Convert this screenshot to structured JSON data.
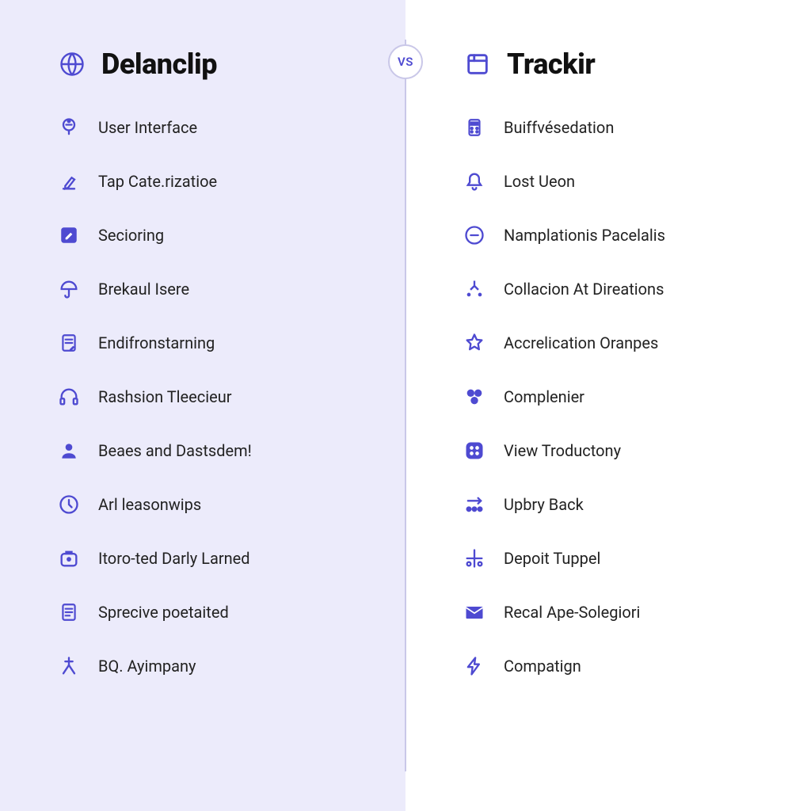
{
  "vs_label": "VS",
  "left": {
    "title": "Delanclip",
    "features": [
      "User Interface",
      "Tap Cate.rizatioe",
      "Secioring",
      "Brekaul Isere",
      "Endifronstarning",
      "Rashsion Tleecieur",
      "Beaes and Dastsdem!",
      "Arl leasonwips",
      "Itoro-ted Darly Larned",
      "Sprecive poetaited",
      "BQ. Ayimpany"
    ]
  },
  "right": {
    "title": "Trackir",
    "features": [
      "Buiffvésedation",
      "Lost Ueon",
      "Namplationis Pacelalis",
      "Collacion At Direations",
      "Accrelication Oranpes",
      "Complenier",
      "View Troductony",
      "Upbry Back",
      "Depoit Tuppel",
      "Recal Ape-Solegiori",
      "Compatign"
    ]
  }
}
